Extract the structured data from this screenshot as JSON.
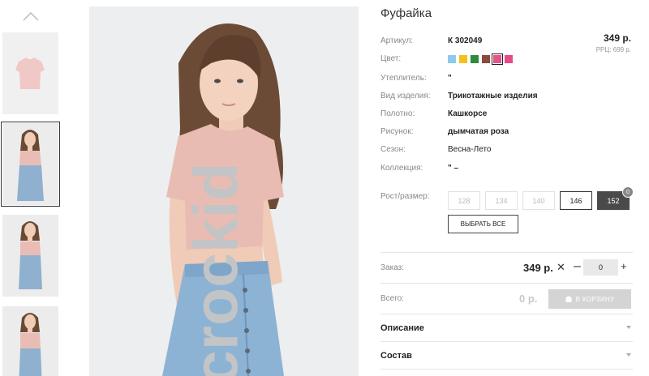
{
  "product": {
    "title": "Фуфайка",
    "price": "349 р.",
    "rrp": "РРЦ: 699 р."
  },
  "specs": {
    "article": {
      "label": "Артикул:",
      "value": "К 302049"
    },
    "color": {
      "label": "Цвет:"
    },
    "insulation": {
      "label": "Утеплитель:",
      "value": "\""
    },
    "type": {
      "label": "Вид изделия:",
      "value": "Трикотажные изделия"
    },
    "fabric": {
      "label": "Полотно:",
      "value": "Кашкорсе"
    },
    "pattern": {
      "label": "Рисунок:",
      "value": "дымчатая роза"
    },
    "season": {
      "label": "Сезон:",
      "value": "Весна-Лето"
    },
    "collection": {
      "label": "Коллекция:",
      "value": "\" –"
    }
  },
  "colors": [
    "#8ec9ee",
    "#f2c21b",
    "#2e8b3a",
    "#8b4a3a",
    "#e8508a",
    "#e84a8a"
  ],
  "sizes": {
    "label": "Рост/размер:",
    "items": [
      {
        "label": "128",
        "state": "disabled"
      },
      {
        "label": "134",
        "state": "disabled"
      },
      {
        "label": "140",
        "state": "disabled"
      },
      {
        "label": "146",
        "state": "available"
      },
      {
        "label": "152",
        "state": "selected",
        "badge": "0"
      }
    ],
    "select_all": "ВЫБРАТЬ ВСЕ"
  },
  "order": {
    "label": "Заказ:",
    "price": "349 р.",
    "times": "✕",
    "minus": "–",
    "plus": "+",
    "qty": "0"
  },
  "total": {
    "label": "Всего:",
    "price": "0 р.",
    "cart_button": "В КОРЗИНУ"
  },
  "accordion": {
    "description": "Описание",
    "composition": "Состав"
  },
  "brand": "crockid"
}
